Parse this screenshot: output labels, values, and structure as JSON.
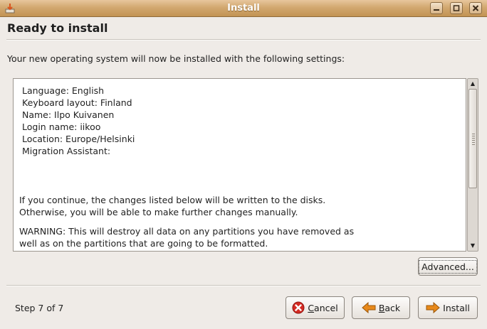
{
  "window": {
    "title": "Install"
  },
  "page": {
    "heading": "Ready to install",
    "intro": "Your new operating system will now be installed with the following settings:"
  },
  "settings": [
    "Language: English",
    "Keyboard layout: Finland",
    "Name: Ilpo Kuivanen",
    "Login name: iikoo",
    "Location: Europe/Helsinki",
    "Migration Assistant:"
  ],
  "notice": {
    "line1": "If you continue, the changes listed below will be written to the disks.",
    "line2": "Otherwise, you will be able to make further changes manually.",
    "warning1": "WARNING: This will destroy all data on any partitions you have removed as",
    "warning2": "well as on the partitions that are going to be formatted."
  },
  "buttons": {
    "advanced": "Advanced...",
    "cancel_prefix": "",
    "cancel_accel": "C",
    "cancel_rest": "ancel",
    "back_accel": "B",
    "back_rest": "ack",
    "install": "Install"
  },
  "footer": {
    "step": "Step 7 of 7"
  },
  "icons": {
    "app": "installer-icon",
    "cancel": "cancel-icon",
    "back": "back-arrow-icon",
    "install": "forward-arrow-icon"
  },
  "colors": {
    "titlebar": "#d2a870",
    "cancel_icon": "#d42a22",
    "arrow_icon": "#e8891a"
  }
}
